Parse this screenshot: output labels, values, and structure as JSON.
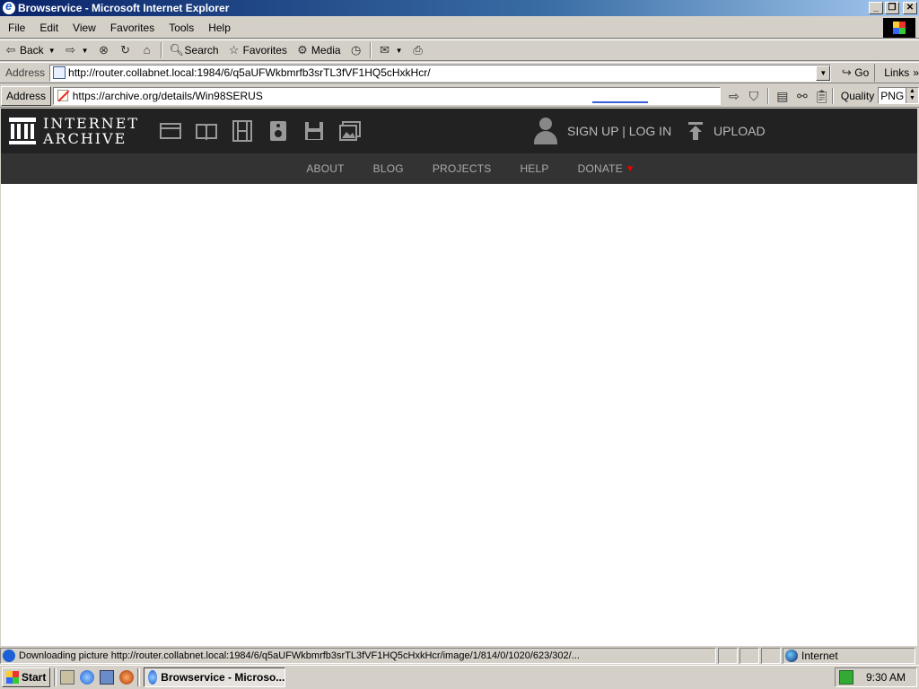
{
  "window": {
    "title": "Browservice - Microsoft Internet Explorer",
    "buttons": {
      "minimize": "_",
      "restore": "❐",
      "close": "✕"
    }
  },
  "menubar": [
    "File",
    "Edit",
    "View",
    "Favorites",
    "Tools",
    "Help"
  ],
  "toolbar": {
    "back": "Back",
    "search": "Search",
    "favorites": "Favorites",
    "media": "Media"
  },
  "ie_address": {
    "label": "Address",
    "url": "http://router.collabnet.local:1984/6/q5aUFWkbmrfb3srTL3fVF1HQ5cHxkHcr/",
    "go": "Go",
    "links": "Links",
    "chevron": "»"
  },
  "browservice": {
    "address_label": "Address",
    "url": "https://archive.org/details/Win98SERUS",
    "quality_label": "Quality",
    "quality_value": "PNG"
  },
  "ia": {
    "logo_line1": "INTERNET",
    "logo_line2": "ARCHIVE",
    "media_icons": [
      "web-icon",
      "texts-icon",
      "video-icon",
      "audio-icon",
      "software-icon",
      "images-icon"
    ],
    "signup_login": "SIGN UP | LOG IN",
    "upload": "UPLOAD",
    "nav": [
      "ABOUT",
      "BLOG",
      "PROJECTS",
      "HELP",
      "DONATE"
    ],
    "heart": "♥",
    "colors": {
      "topbar": "#222222",
      "navbar": "#333333",
      "heart": "#e00000"
    }
  },
  "status": {
    "text": "Downloading picture http://router.collabnet.local:1984/6/q5aUFWkbmrfb3srTL3fVF1HQ5cHxkHcr/image/1/814/0/1020/623/302/...",
    "zone": "Internet"
  },
  "taskbar": {
    "start": "Start",
    "task": "Browservice - Microso...",
    "clock": "9:30 AM"
  }
}
